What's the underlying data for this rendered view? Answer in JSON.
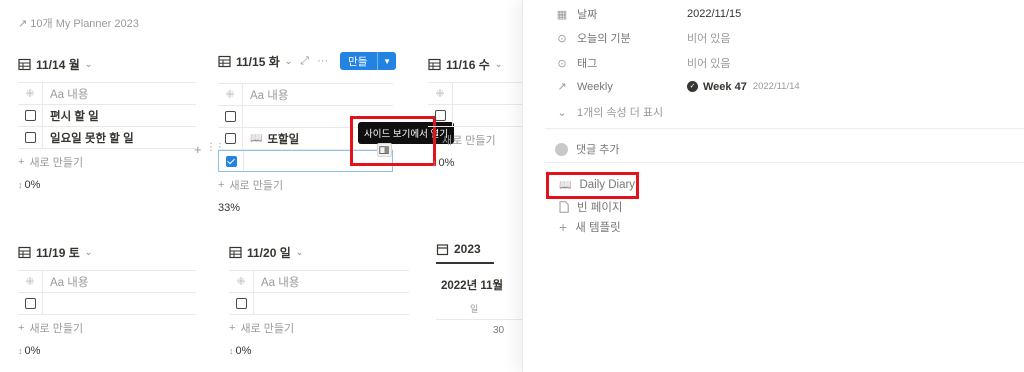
{
  "breadcrumb": {
    "arrow": "↗",
    "label": "10개 My Planner 2023"
  },
  "common": {
    "content_col": "Aa 내용",
    "new_row": "새로 만들기"
  },
  "views": {
    "v1114": {
      "title": "11/14 월",
      "rows": [
        {
          "text": "편시 할 일",
          "checked": false
        },
        {
          "text": "일요일 못한 할 일",
          "checked": false
        }
      ],
      "pct": "0%"
    },
    "v1115": {
      "title": "11/15 화",
      "new_button": "새로 만들기",
      "row_text": "또할일",
      "pct": "33%",
      "tooltip": "사이드 보기에서 열기"
    },
    "v1116": {
      "title": "11/16 수",
      "pct": "0%"
    },
    "v1119": {
      "title": "11/19 토",
      "pct": "0%"
    },
    "v1120": {
      "title": "11/20 일",
      "pct": "0%"
    },
    "calendar": {
      "tab": "2023",
      "month": "2022년 11월",
      "weekday": "일",
      "day": "30"
    }
  },
  "panel": {
    "props": {
      "date_label": "날짜",
      "date_value": "2022/11/15",
      "mood_label": "오늘의 기분",
      "mood_value": "비어 있음",
      "tag_label": "태그",
      "tag_value": "비어 있음",
      "weekly_label": "Weekly",
      "weekly_value": "Week 47",
      "weekly_date": "2022/11/14",
      "more": "1개의 속성 더 표시"
    },
    "comment": "댓글 추가",
    "templates": {
      "daily": "Daily Diary",
      "blank": "빈 페이지",
      "new": "새 템플릿"
    }
  },
  "colors": {
    "accent": "#2383e2",
    "highlight": "#e3121b"
  }
}
